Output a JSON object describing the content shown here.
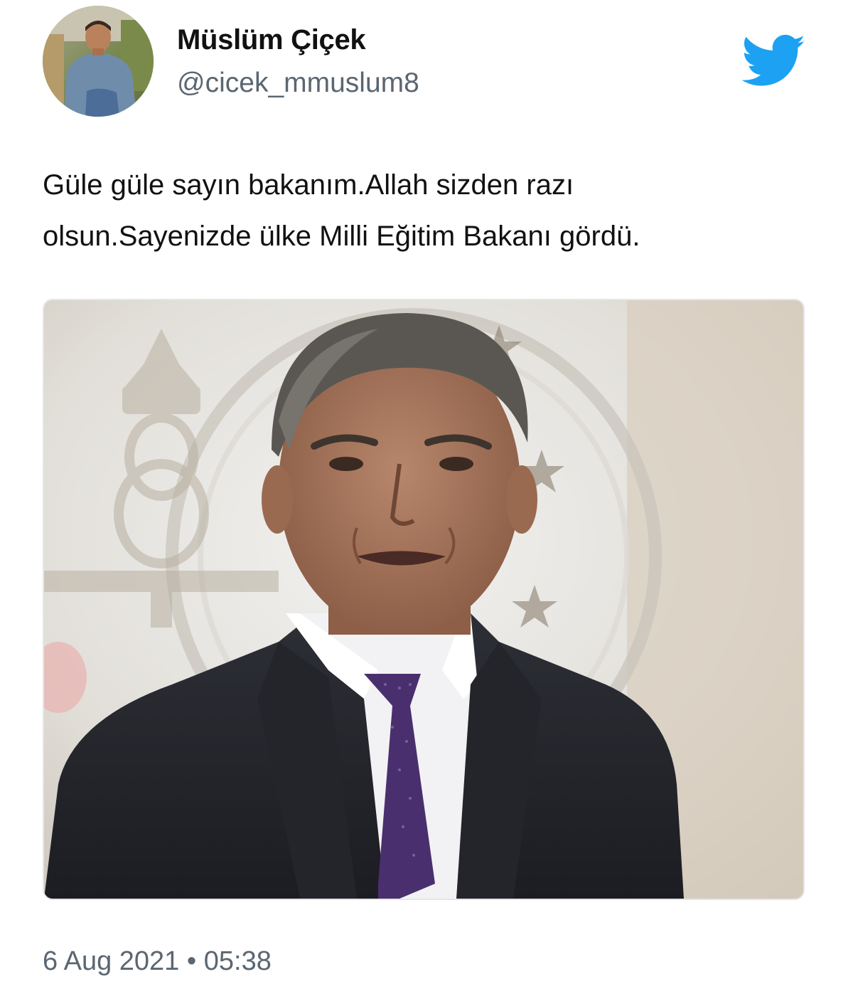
{
  "author": {
    "display_name": "Müslüm Çiçek",
    "handle": "@cicek_mmuslum8",
    "avatar_icon": "user-avatar-photo"
  },
  "brand": {
    "logo_icon": "twitter-bird-icon",
    "color": "#1da1f2"
  },
  "tweet": {
    "text_lines": [
      "Güle güle sayın bakanım.Allah sizden razı",
      "olsun.Sayenizde ülke Milli Eğitim Bakanı gördü."
    ],
    "media_description_icon": "attached-photo",
    "date": "6 Aug 2021",
    "separator": "•",
    "time": "05:38"
  }
}
